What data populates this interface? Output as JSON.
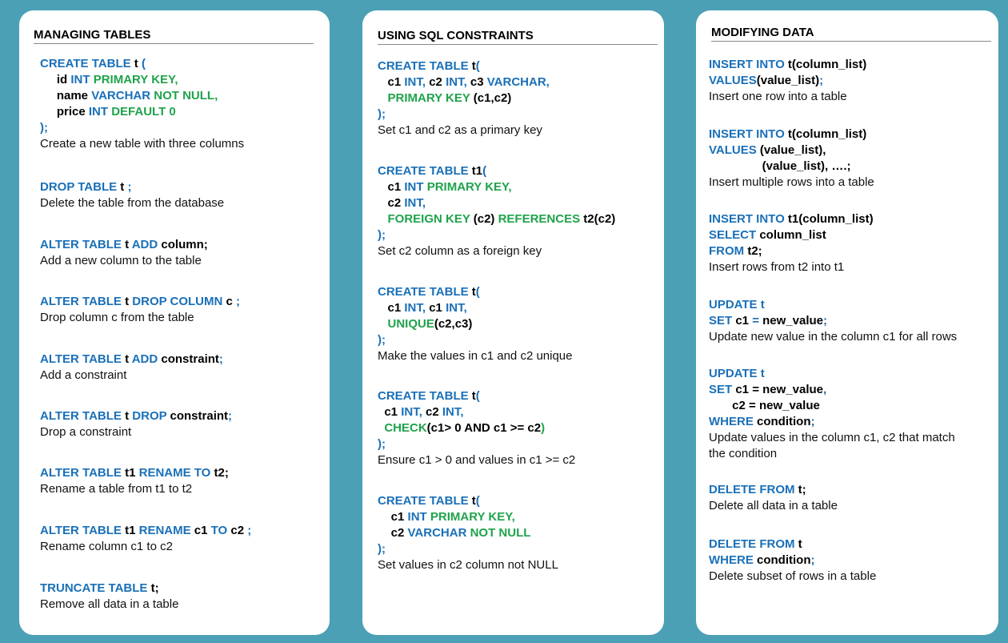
{
  "colors": {
    "background": "#4ba0b5",
    "keyword": "#1a70b8",
    "green": "#1fa34b",
    "panel": "#ffffff"
  },
  "panels": [
    {
      "title": "MANAGING TABLES",
      "entries": [
        {
          "code": [
            [
              [
                "CREATE TABLE ",
                "kw"
              ],
              [
                "t",
                "bk"
              ],
              [
                " (",
                "kw"
              ]
            ],
            [
              [
                "     id ",
                "bk"
              ],
              [
                "INT ",
                "kw"
              ],
              [
                "PRIMARY KEY,",
                "gr"
              ]
            ],
            [
              [
                "     name ",
                "bk"
              ],
              [
                "VARCHAR ",
                "kw"
              ],
              [
                "NOT NULL,",
                "gr"
              ]
            ],
            [
              [
                "     price ",
                "bk"
              ],
              [
                "INT ",
                "kw"
              ],
              [
                "DEFAULT 0",
                "gr"
              ]
            ],
            [
              [
                ");",
                "kw"
              ]
            ]
          ],
          "desc": "Create a new table with three columns"
        },
        {
          "code": [
            [
              [
                "DROP TABLE ",
                "kw"
              ],
              [
                "t",
                "bk"
              ],
              [
                " ;",
                "kw"
              ]
            ]
          ],
          "desc": "Delete the table from the database"
        },
        {
          "code": [
            [
              [
                "ALTER TABLE ",
                "kw"
              ],
              [
                "t ",
                "bk"
              ],
              [
                "ADD ",
                "kw"
              ],
              [
                "column;",
                "bk"
              ]
            ]
          ],
          "desc": "Add a new column to the table"
        },
        {
          "code": [
            [
              [
                "ALTER TABLE ",
                "kw"
              ],
              [
                "t ",
                "bk"
              ],
              [
                "DROP COLUMN ",
                "kw"
              ],
              [
                "c",
                "bk"
              ],
              [
                " ;",
                "kw"
              ]
            ]
          ],
          "desc": "Drop column c from the table"
        },
        {
          "code": [
            [
              [
                "ALTER TABLE ",
                "kw"
              ],
              [
                "t ",
                "bk"
              ],
              [
                "ADD ",
                "kw"
              ],
              [
                "constraint",
                "bk"
              ],
              [
                ";",
                "kw"
              ]
            ]
          ],
          "desc": "Add a constraint"
        },
        {
          "code": [
            [
              [
                "ALTER TABLE ",
                "kw"
              ],
              [
                "t ",
                "bk"
              ],
              [
                "DROP ",
                "kw"
              ],
              [
                "constraint",
                "bk"
              ],
              [
                ";",
                "kw"
              ]
            ]
          ],
          "desc": "Drop a constraint"
        },
        {
          "code": [
            [
              [
                "ALTER TABLE ",
                "kw"
              ],
              [
                "t1 ",
                "bk"
              ],
              [
                "RENAME TO ",
                "kw"
              ],
              [
                "t2;",
                "bk"
              ]
            ]
          ],
          "desc": "Rename a table from t1 to t2"
        },
        {
          "code": [
            [
              [
                "ALTER TABLE ",
                "kw"
              ],
              [
                "t1 ",
                "bk"
              ],
              [
                "RENAME ",
                "kw"
              ],
              [
                "c1 ",
                "bk"
              ],
              [
                "TO ",
                "kw"
              ],
              [
                "c2",
                "bk"
              ],
              [
                " ;",
                "kw"
              ]
            ]
          ],
          "desc": "Rename column c1 to c2"
        },
        {
          "code": [
            [
              [
                "TRUNCATE TABLE ",
                "kw"
              ],
              [
                "t;",
                "bk"
              ]
            ]
          ],
          "desc": "Remove all data in a table"
        }
      ]
    },
    {
      "title": "USING SQL CONSTRAINTS",
      "entries": [
        {
          "code": [
            [
              [
                "CREATE TABLE ",
                "kw"
              ],
              [
                "t",
                "bk"
              ],
              [
                "(",
                "kw"
              ]
            ],
            [
              [
                "   c1 ",
                "bk"
              ],
              [
                "INT, ",
                "kw"
              ],
              [
                "c2 ",
                "bk"
              ],
              [
                "INT, ",
                "kw"
              ],
              [
                "c3 ",
                "bk"
              ],
              [
                "VARCHAR,",
                "kw"
              ]
            ],
            [
              [
                "   PRIMARY KEY ",
                "gr"
              ],
              [
                "(c1,c2)",
                "bk"
              ]
            ],
            [
              [
                ");",
                "kw"
              ]
            ]
          ],
          "desc": "Set c1 and c2 as a primary key"
        },
        {
          "code": [
            [
              [
                "CREATE TABLE ",
                "kw"
              ],
              [
                "t1",
                "bk"
              ],
              [
                "(",
                "kw"
              ]
            ],
            [
              [
                "   c1 ",
                "bk"
              ],
              [
                "INT ",
                "kw"
              ],
              [
                "PRIMARY KEY,",
                "gr"
              ]
            ],
            [
              [
                "   c2 ",
                "bk"
              ],
              [
                "INT,",
                "kw"
              ]
            ],
            [
              [
                "   FOREIGN KEY ",
                "gr"
              ],
              [
                "(c2) ",
                "bk"
              ],
              [
                "REFERENCES ",
                "gr"
              ],
              [
                "t2(c2)",
                "bk"
              ]
            ],
            [
              [
                ");",
                "kw"
              ]
            ]
          ],
          "desc": "Set c2 column as a foreign key"
        },
        {
          "code": [
            [
              [
                "CREATE TABLE ",
                "kw"
              ],
              [
                "t",
                "bk"
              ],
              [
                "(",
                "kw"
              ]
            ],
            [
              [
                "   c1 ",
                "bk"
              ],
              [
                "INT, ",
                "kw"
              ],
              [
                "c1 ",
                "bk"
              ],
              [
                "INT,",
                "kw"
              ]
            ],
            [
              [
                "   UNIQUE",
                "gr"
              ],
              [
                "(c2,c3)",
                "bk"
              ]
            ],
            [
              [
                ");",
                "kw"
              ]
            ]
          ],
          "desc": "Make the values in c1 and c2 unique"
        },
        {
          "code": [
            [
              [
                "CREATE TABLE ",
                "kw"
              ],
              [
                "t",
                "bk"
              ],
              [
                "(",
                "kw"
              ]
            ],
            [
              [
                "  c1 ",
                "bk"
              ],
              [
                "INT, ",
                "kw"
              ],
              [
                "c2 ",
                "bk"
              ],
              [
                "INT,",
                "kw"
              ]
            ],
            [
              [
                "  CHECK",
                "gr"
              ],
              [
                "(c1> 0 AND c1 >= c2",
                "bk"
              ],
              [
                ")",
                "gr"
              ]
            ],
            [
              [
                ");",
                "kw"
              ]
            ]
          ],
          "desc": "Ensure c1 > 0 and values in c1 >= c2"
        },
        {
          "code": [
            [
              [
                "CREATE TABLE ",
                "kw"
              ],
              [
                "t",
                "bk"
              ],
              [
                "(",
                "kw"
              ]
            ],
            [
              [
                "    c1 ",
                "bk"
              ],
              [
                "INT ",
                "kw"
              ],
              [
                "PRIMARY KEY,",
                "gr"
              ]
            ],
            [
              [
                "    c2 ",
                "bk"
              ],
              [
                "VARCHAR ",
                "kw"
              ],
              [
                "NOT NULL",
                "gr"
              ]
            ],
            [
              [
                ");",
                "kw"
              ]
            ]
          ],
          "desc": "Set values in c2 column not NULL"
        }
      ]
    },
    {
      "title": "MODIFYING DATA",
      "entries": [
        {
          "code": [
            [
              [
                "INSERT INTO ",
                "kw"
              ],
              [
                "t(column_list)",
                "bk"
              ]
            ],
            [
              [
                "VALUES",
                "kw"
              ],
              [
                "(value_list)",
                "bk"
              ],
              [
                ";",
                "kw"
              ]
            ]
          ],
          "desc": "Insert one row into a table"
        },
        {
          "code": [
            [
              [
                "INSERT INTO ",
                "kw"
              ],
              [
                "t(column_list)",
                "bk"
              ]
            ],
            [
              [
                "VALUES ",
                "kw"
              ],
              [
                "(value_list),",
                "bk"
              ]
            ],
            [
              [
                "                (value_list), ….;",
                "bk"
              ]
            ]
          ],
          "desc": "Insert multiple rows into a table"
        },
        {
          "code": [
            [
              [
                "INSERT INTO ",
                "kw"
              ],
              [
                "t1(column_list)",
                "bk"
              ]
            ],
            [
              [
                "SELECT ",
                "kw"
              ],
              [
                "column_list",
                "bk"
              ]
            ],
            [
              [
                "FROM ",
                "kw"
              ],
              [
                "t2;",
                "bk"
              ]
            ]
          ],
          "desc": "Insert rows from t2 into t1"
        },
        {
          "code": [
            [
              [
                "UPDATE ",
                "kw"
              ],
              [
                "t",
                "kw"
              ]
            ],
            [
              [
                "SET ",
                "kw"
              ],
              [
                "c1 ",
                "bk"
              ],
              [
                "= ",
                "kw"
              ],
              [
                "new_value",
                "bk"
              ],
              [
                ";",
                "kw"
              ]
            ]
          ],
          "desc": "Update new value in the column c1 for all rows"
        },
        {
          "code": [
            [
              [
                "UPDATE ",
                "kw"
              ],
              [
                "t",
                "kw"
              ]
            ],
            [
              [
                "SET ",
                "kw"
              ],
              [
                "c1 ",
                "bk"
              ],
              [
                "= ",
                "bk"
              ],
              [
                "new_value",
                "bk"
              ],
              [
                ",",
                "kw"
              ]
            ],
            [
              [
                "       c2 = new_value",
                "bk"
              ]
            ],
            [
              [
                "WHERE ",
                "kw"
              ],
              [
                "condition",
                "bk"
              ],
              [
                ";",
                "kw"
              ]
            ]
          ],
          "desc": "Update values in the column c1, c2 that match\nthe condition"
        },
        {
          "code": [
            [
              [
                "DELETE FROM ",
                "kw"
              ],
              [
                "t;",
                "bk"
              ]
            ]
          ],
          "desc": "Delete all data in a table"
        },
        {
          "code": [
            [
              [
                "DELETE FROM ",
                "kw"
              ],
              [
                "t",
                "bk"
              ]
            ],
            [
              [
                "WHERE ",
                "kw"
              ],
              [
                "condition",
                "bk"
              ],
              [
                ";",
                "kw"
              ]
            ]
          ],
          "desc": "Delete subset of rows in a table"
        }
      ]
    }
  ]
}
